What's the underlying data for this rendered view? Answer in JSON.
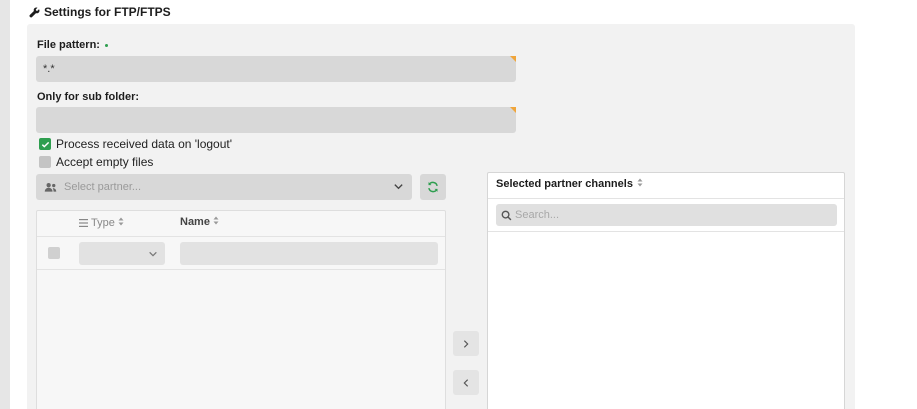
{
  "section": {
    "title": "Settings for FTP/FTPS"
  },
  "file_pattern": {
    "label": "File pattern:",
    "value": "*.*"
  },
  "sub_folder": {
    "label": "Only for sub folder:",
    "value": ""
  },
  "options": {
    "process_logout": {
      "label": "Process received data on 'logout'",
      "checked": true
    },
    "accept_empty": {
      "label": "Accept empty files",
      "checked": false
    }
  },
  "partner_select": {
    "placeholder": "Select partner..."
  },
  "partner_table": {
    "columns": [
      {
        "label": "Type"
      },
      {
        "label": "Name"
      }
    ]
  },
  "selected_channels": {
    "title": "Selected partner channels",
    "search_placeholder": "Search..."
  },
  "colors": {
    "accent_green": "#2e9e4f",
    "required_marker": "#f0a53a"
  }
}
